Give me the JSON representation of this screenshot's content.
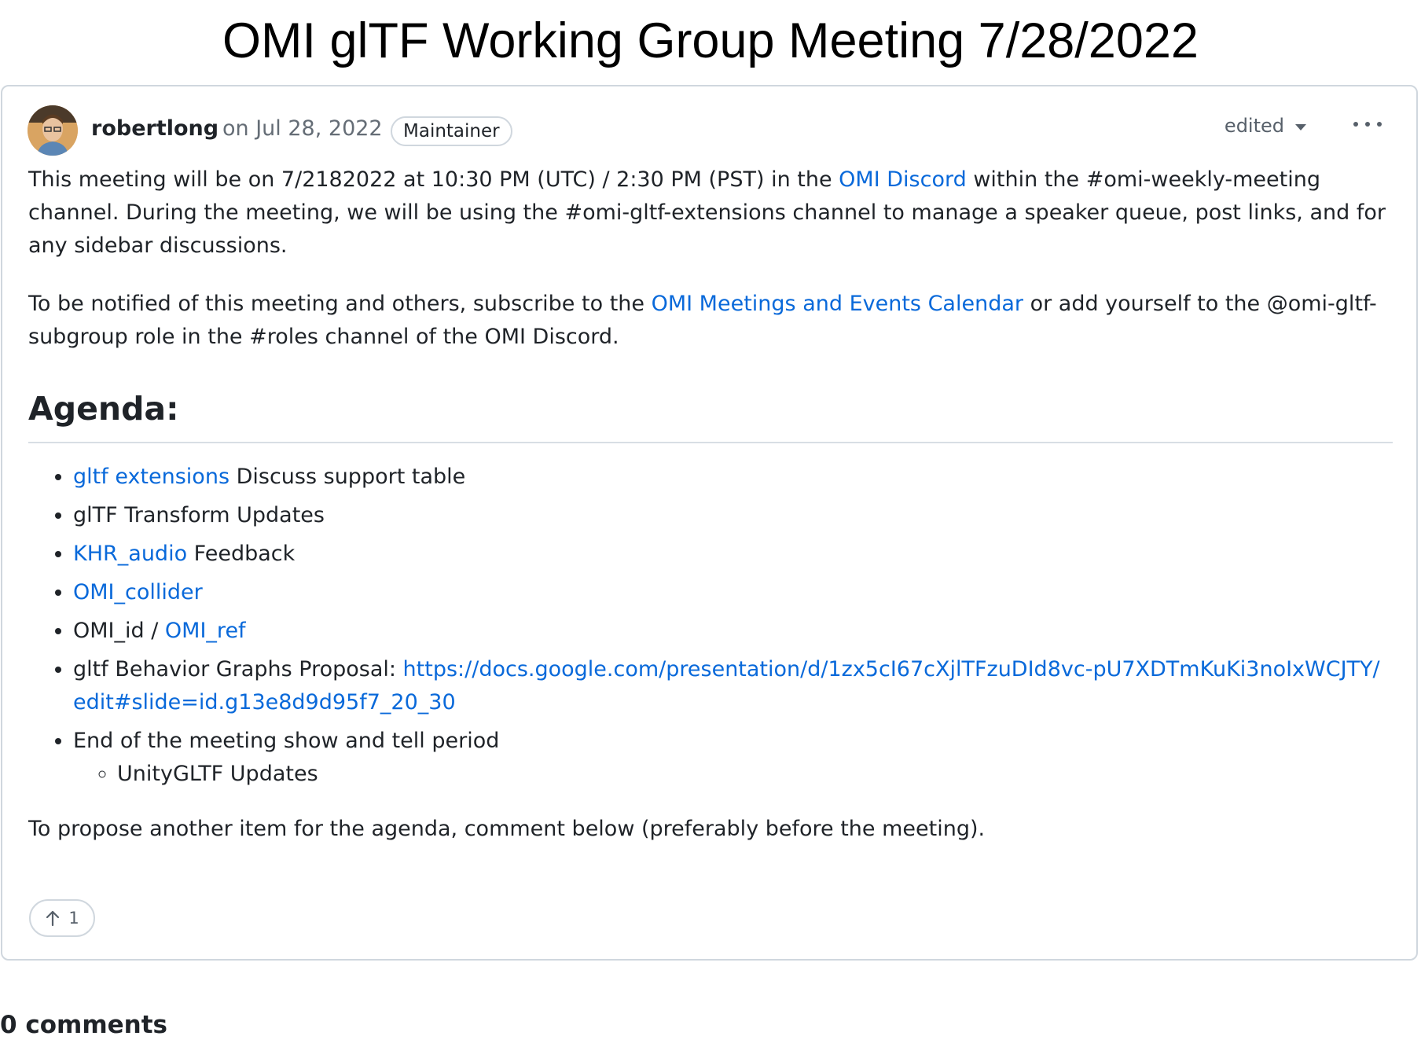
{
  "page": {
    "title": "OMI glTF Working Group Meeting 7/28/2022"
  },
  "post": {
    "author": "robertlong",
    "date": "on Jul 28, 2022",
    "role_badge": "Maintainer",
    "edited_label": "edited",
    "paragraph1": {
      "before": "This meeting will be on 7/2182022 at 10:30 PM (UTC) / 2:30 PM (PST) in the ",
      "link": "OMI Discord",
      "after": " within the #omi-weekly-meeting channel. During the meeting, we will be using the #omi-gltf-extensions channel to manage a speaker queue, post links, and for any sidebar discussions."
    },
    "paragraph2": {
      "before": "To be notified of this meeting and others, subscribe to the ",
      "link": "OMI Meetings and Events Calendar",
      "after": " or add yourself to the @omi-gltf-subgroup role in the #roles channel of the OMI Discord."
    },
    "agenda_heading": "Agenda:",
    "agenda": [
      {
        "link": "gltf extensions",
        "text": " Discuss support table"
      },
      {
        "text": "glTF Transform Updates"
      },
      {
        "link": "KHR_audio",
        "text": " Feedback"
      },
      {
        "link": "OMI_collider"
      },
      {
        "text": "OMI_id / ",
        "link": "OMI_ref"
      },
      {
        "text": "gltf Behavior Graphs Proposal: ",
        "link": "https://docs.google.com/presentation/d/1zx5cI67cXjlTFzuDId8vc-pU7XDTmKuKi3noIxWCJTY/edit#slide=id.g13e8d9d95f7_20_30"
      },
      {
        "text": "End of the meeting show and tell period",
        "sub": [
          "UnityGLTF Updates"
        ]
      }
    ],
    "closing": "To propose another item for the agenda, comment below (preferably before the meeting).",
    "upvote_icon": "arrow-up-icon",
    "upvote_count": "1"
  },
  "comments_heading": "0 comments",
  "colors": {
    "link": "#0969da",
    "border": "#d0d7de",
    "muted": "#656d76",
    "text": "#1f2328"
  }
}
